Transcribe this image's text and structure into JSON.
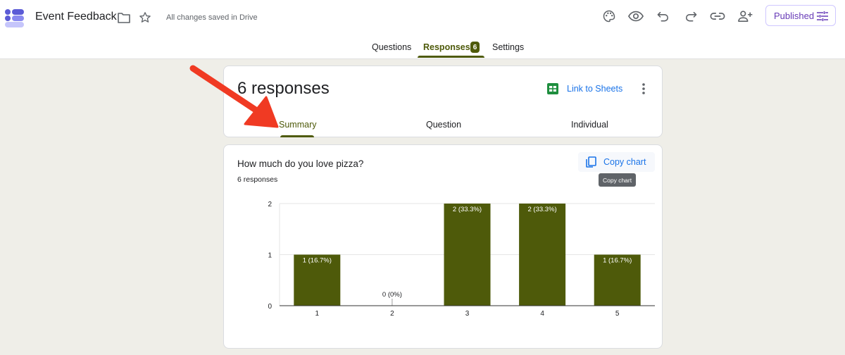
{
  "app": {
    "title": "Event Feedback",
    "save_status": "All changes saved in Drive",
    "published_label": "Published"
  },
  "icons": {
    "logo": "forms-logo-icon",
    "folder": "folder-icon",
    "star": "star-icon",
    "palette": "palette-icon",
    "preview": "eye-icon",
    "undo": "undo-icon",
    "redo": "redo-icon",
    "link": "link-icon",
    "collaborators": "add-person-icon",
    "published": "tune-icon",
    "sheets": "sheets-icon",
    "more": "more-vert-icon",
    "copy": "copy-icon"
  },
  "main_tabs": [
    {
      "label": "Questions"
    },
    {
      "label": "Responses",
      "badge": "6",
      "active": true
    },
    {
      "label": "Settings"
    }
  ],
  "responses_card": {
    "title": "6 responses",
    "link_sheets_label": "Link to Sheets",
    "sub_tabs": [
      {
        "label": "Summary",
        "active": true
      },
      {
        "label": "Question"
      },
      {
        "label": "Individual"
      }
    ]
  },
  "question_card": {
    "question": "How much do you love pizza?",
    "response_count": "6 responses",
    "copy_chart_label": "Copy chart",
    "tooltip": "Copy chart"
  },
  "colors": {
    "accent": "#4e5a0a",
    "link_blue": "#1a73e8",
    "published_purple": "#673ab7",
    "background": "#efeee8",
    "arrow": "#f03a23"
  },
  "chart_data": {
    "type": "bar",
    "categories": [
      "1",
      "2",
      "3",
      "4",
      "5"
    ],
    "values": [
      1,
      0,
      2,
      2,
      1
    ],
    "labels": [
      "1 (16.7%)",
      "0 (0%)",
      "2 (33.3%)",
      "2 (33.3%)",
      "1 (16.7%)"
    ],
    "yticks": [
      "0",
      "1",
      "2"
    ],
    "ylim": [
      0,
      2
    ],
    "grid": true,
    "color": "#4e5a0a"
  }
}
